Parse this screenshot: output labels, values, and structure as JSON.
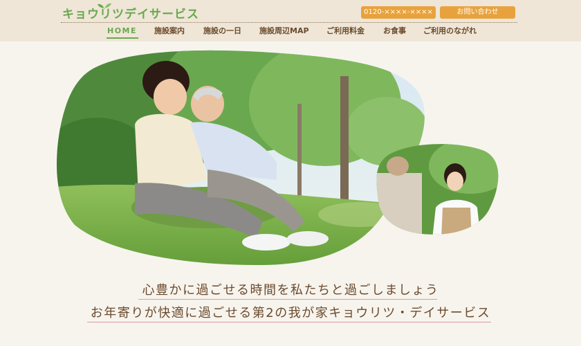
{
  "header": {
    "logo_text": "キョウリツデイサービス",
    "phone": "0120-××××-××××",
    "contact_label": "お問い合わせ"
  },
  "nav": {
    "items": [
      {
        "label": "HOME"
      },
      {
        "label": "施設案内"
      },
      {
        "label": "施設の一日"
      },
      {
        "label": "施設周辺MAP"
      },
      {
        "label": "ご利用料金"
      },
      {
        "label": "お食事"
      },
      {
        "label": "ご利用のながれ"
      }
    ]
  },
  "hero": {
    "tagline_1": "心豊かに過ごせる時間を私たちと過ごしましょう",
    "tagline_2": "お年寄りが快適に過ごせる第2の我が家キョウリツ・デイサービス"
  },
  "colors": {
    "accent_green": "#6aa84f",
    "button_orange": "#e8a23d",
    "text_brown": "#6b4a2c",
    "header_bg": "#efe6d7",
    "page_bg": "#f7f4ee"
  }
}
